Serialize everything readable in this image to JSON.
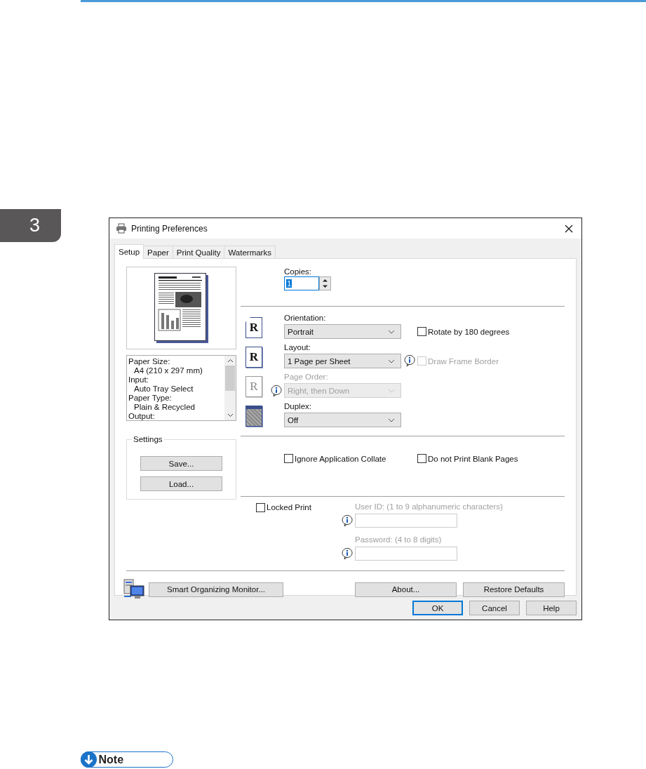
{
  "page": {
    "chapter": "3",
    "note_heading": "Note"
  },
  "window": {
    "title": "Printing Preferences"
  },
  "tabs": [
    {
      "label": "Setup",
      "selected": true
    },
    {
      "label": "Paper",
      "selected": false
    },
    {
      "label": "Print Quality",
      "selected": false
    },
    {
      "label": "Watermarks",
      "selected": false
    }
  ],
  "summary": [
    {
      "label": "Paper Size:",
      "children": [
        {
          "label": "A4 (210 x 297 mm)"
        }
      ]
    },
    {
      "label": "Input:",
      "children": [
        {
          "label": "Auto Tray Select"
        }
      ]
    },
    {
      "label": "Paper Type:",
      "children": [
        {
          "label": "Plain & Recycled"
        }
      ]
    },
    {
      "label": "Output:"
    }
  ],
  "settings": {
    "title": "Settings",
    "buttons": [
      "Save...",
      "Load..."
    ]
  },
  "copies": {
    "label": "Copies:",
    "value": "1"
  },
  "fields": [
    {
      "kind": "orientation",
      "glyph": "R",
      "label": "Orientation:",
      "value": "Portrait",
      "disabled": false,
      "checkbox": {
        "label": "Rotate by 180 degrees",
        "checked": false,
        "disabled": false
      }
    },
    {
      "kind": "layout",
      "glyph": "R",
      "label": "Layout:",
      "value": "1 Page per Sheet",
      "disabled": false,
      "info_after": true,
      "checkbox": {
        "label": "Draw Frame Border",
        "checked": false,
        "disabled": true
      }
    },
    {
      "kind": "page-order",
      "glyph": "R",
      "label": "Page Order:",
      "value": "Right, then Down",
      "disabled": true,
      "info_before": true
    },
    {
      "kind": "duplex",
      "label": "Duplex:",
      "value": "Off",
      "disabled": false
    }
  ],
  "options": [
    {
      "label": "Ignore Application Collate",
      "checked": false
    },
    {
      "label": "Do not Print Blank Pages",
      "checked": false
    }
  ],
  "locked_print": {
    "label": "Locked Print",
    "checked": false,
    "fields": [
      {
        "label": "User ID: (1 to 9 alphanumeric characters)",
        "disabled": true
      },
      {
        "label": "Password: (4 to 8 digits)",
        "disabled": true
      }
    ]
  },
  "footer_buttons": [
    {
      "label": "Smart Organizing Monitor..."
    },
    {
      "label": "About..."
    },
    {
      "label": "Restore Defaults"
    }
  ],
  "dialog_buttons": [
    {
      "label": "OK",
      "default": true
    },
    {
      "label": "Cancel",
      "default": false
    },
    {
      "label": "Help",
      "default": false
    }
  ]
}
